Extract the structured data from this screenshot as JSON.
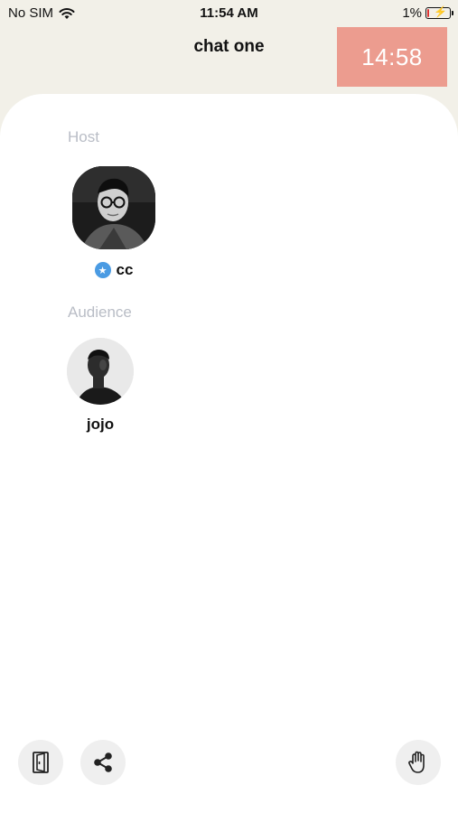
{
  "status": {
    "carrier": "No SIM",
    "time": "11:54 AM",
    "battery": "1%",
    "battery_level": 0.01
  },
  "nav": {
    "title": "chat one",
    "timer": "14:58",
    "timer_color": "#ec9c8f"
  },
  "room": {
    "host_label": "Host",
    "audience_label": "Audience",
    "host": {
      "name": "cc",
      "badge_icon": "star-icon",
      "badge_color": "#4a9be3"
    },
    "audience": [
      {
        "name": "jojo"
      }
    ]
  },
  "toolbar": {
    "leave_icon": "door-icon",
    "share_icon": "share-icon",
    "raise_hand_icon": "hand-icon"
  }
}
